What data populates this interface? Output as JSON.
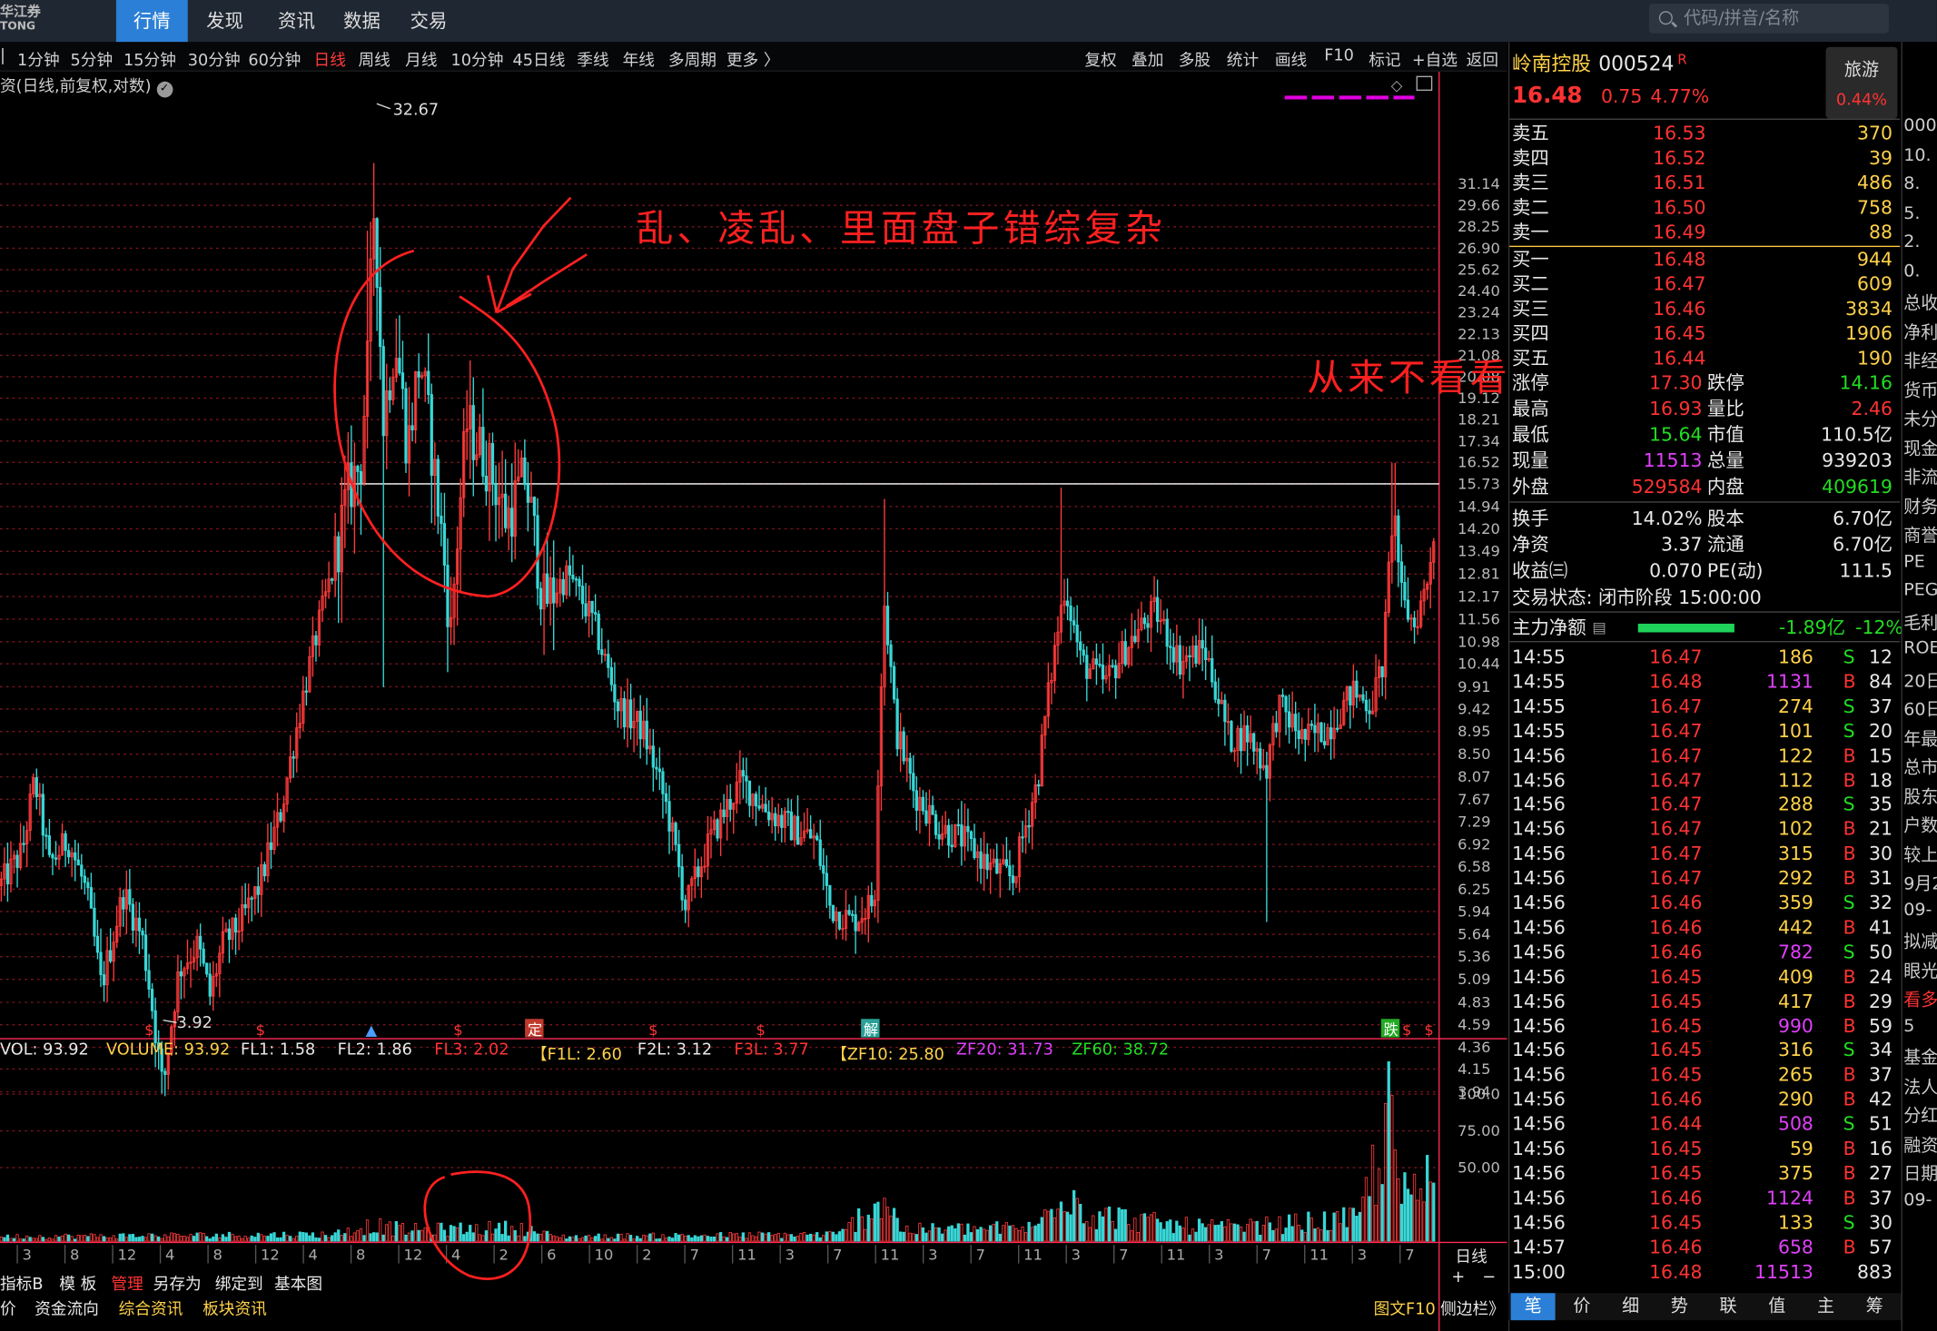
{
  "app": {
    "logo_lines": [
      "华江券",
      "TONG"
    ]
  },
  "menu": [
    "行情",
    "发现",
    "资讯",
    "数据",
    "交易"
  ],
  "search": {
    "placeholder": "代码/拼音/名称"
  },
  "periods": [
    "1分钟",
    "5分钟",
    "15分钟",
    "30分钟",
    "60分钟",
    "日线",
    "周线",
    "月线",
    "10分钟",
    "45日线",
    "季线",
    "年线",
    "多周期",
    "更多 〉"
  ],
  "tools": [
    "复权",
    "叠加",
    "多股",
    "统计",
    "画线",
    "F10",
    "标记",
    "+自选",
    "返回"
  ],
  "chart": {
    "title": "资(日线,前复权,对数)",
    "high_label": "32.67",
    "low_label": "3.92",
    "ref_line": 15.73,
    "axis_ticks": [
      "31.14",
      "29.66",
      "28.25",
      "26.90",
      "25.62",
      "24.40",
      "23.24",
      "22.13",
      "21.08",
      "20.08",
      "19.12",
      "18.21",
      "17.34",
      "16.52",
      "15.73",
      "14.94",
      "14.20",
      "13.49",
      "12.81",
      "12.17",
      "11.56",
      "10.98",
      "10.44",
      "9.91",
      "9.42",
      "8.95",
      "8.50",
      "8.07",
      "7.67",
      "7.29",
      "6.92",
      "6.58",
      "6.25",
      "5.94",
      "5.64",
      "5.36",
      "5.09",
      "4.83",
      "4.59",
      "4.36",
      "4.15",
      "3.94"
    ],
    "markers": [
      "$",
      "$",
      "$",
      "$",
      "定",
      "$",
      "$",
      "解",
      "跌",
      "$",
      "$"
    ],
    "date_labels": [
      "3",
      "8",
      "12",
      "4",
      "8",
      "12",
      "4",
      "8",
      "12",
      "4",
      "2",
      "6",
      "10",
      "2",
      "7",
      "11",
      "3",
      "7",
      "11",
      "3",
      "7",
      "11",
      "3",
      "7",
      "11",
      "3",
      "7",
      "11",
      "3",
      "7"
    ],
    "period_tag": "日线"
  },
  "volume": {
    "legend": [
      [
        "VOL: 93.92",
        "#e8e8e8"
      ],
      [
        "VOLUME: 93.92",
        "#ffd24a"
      ],
      [
        "FL1: 1.58",
        "#e8e8e8"
      ],
      [
        "FL2: 1.86",
        "#e8e8e8"
      ],
      [
        "FL3: 2.02",
        "#ff3333"
      ],
      [
        "【F1L: 2.60",
        "#ffd24a"
      ],
      [
        "F2L: 3.12",
        "#e8e8e8"
      ],
      [
        "F3L: 3.77",
        "#ff3333"
      ],
      [
        "【ZF10: 25.80",
        "#ffd24a"
      ],
      [
        "ZF20: 31.73",
        "#e040fb"
      ],
      [
        "ZF60: 38.72",
        "#22dd22"
      ]
    ],
    "axis": [
      "100.0",
      "75.00",
      "50.00"
    ]
  },
  "bottom": {
    "tabs1": [
      "指标B",
      "模 板",
      "管理",
      "另存为",
      "绑定到",
      "基本图"
    ],
    "tabs2": [
      "价",
      "资金流向",
      "综合资讯",
      "板块资讯"
    ],
    "right_links": [
      "图文F10",
      "侧边栏》"
    ]
  },
  "annotations": {
    "text1": "乱、凌乱、里面盘子错综复杂",
    "text2": "从来不看看走势，先脑往里冲"
  },
  "quote": {
    "name": "岭南控股",
    "code": "000524",
    "flag": "R",
    "price": "16.48",
    "change": "0.75",
    "pct": "4.77%",
    "sector": "旅游",
    "sector_pct": "0.44%",
    "asks": [
      [
        "卖五",
        "16.53",
        "370"
      ],
      [
        "卖四",
        "16.52",
        "39"
      ],
      [
        "卖三",
        "16.51",
        "486"
      ],
      [
        "卖二",
        "16.50",
        "758"
      ],
      [
        "卖一",
        "16.49",
        "88"
      ]
    ],
    "bids": [
      [
        "买一",
        "16.48",
        "944"
      ],
      [
        "买二",
        "16.47",
        "609"
      ],
      [
        "买三",
        "16.46",
        "3834"
      ],
      [
        "买四",
        "16.45",
        "1906"
      ],
      [
        "买五",
        "16.44",
        "190"
      ]
    ],
    "stats": [
      [
        "涨停",
        "17.30",
        "跌停",
        "14.16"
      ],
      [
        "最高",
        "16.93",
        "量比",
        "2.46"
      ],
      [
        "最低",
        "15.64",
        "市值",
        "110.5亿"
      ],
      [
        "现量",
        "11513",
        "总量",
        "939203"
      ],
      [
        "外盘",
        "529584",
        "内盘",
        "409619"
      ]
    ],
    "stats2": [
      [
        "换手",
        "14.02%",
        "股本",
        "6.70亿"
      ],
      [
        "净资",
        "3.37",
        "流通",
        "6.70亿"
      ],
      [
        "收益㈢",
        "0.070",
        "PE(动)",
        "111.5"
      ]
    ],
    "status": "交易状态: 闭市阶段 15:00:00",
    "flow": {
      "label": "主力净额",
      "value": "-1.89亿",
      "pct": "-12%"
    }
  },
  "ticks": [
    [
      "14:55",
      "16.47",
      "186",
      "S",
      "12"
    ],
    [
      "14:55",
      "16.48",
      "1131",
      "B",
      "84"
    ],
    [
      "14:55",
      "16.47",
      "274",
      "S",
      "37"
    ],
    [
      "14:55",
      "16.47",
      "101",
      "S",
      "20"
    ],
    [
      "14:56",
      "16.47",
      "122",
      "B",
      "15"
    ],
    [
      "14:56",
      "16.47",
      "112",
      "B",
      "18"
    ],
    [
      "14:56",
      "16.47",
      "288",
      "S",
      "35"
    ],
    [
      "14:56",
      "16.47",
      "102",
      "B",
      "21"
    ],
    [
      "14:56",
      "16.47",
      "315",
      "B",
      "30"
    ],
    [
      "14:56",
      "16.47",
      "292",
      "B",
      "31"
    ],
    [
      "14:56",
      "16.46",
      "359",
      "S",
      "32"
    ],
    [
      "14:56",
      "16.46",
      "442",
      "B",
      "41"
    ],
    [
      "14:56",
      "16.46",
      "782",
      "S",
      "50"
    ],
    [
      "14:56",
      "16.45",
      "409",
      "B",
      "24"
    ],
    [
      "14:56",
      "16.45",
      "417",
      "B",
      "29"
    ],
    [
      "14:56",
      "16.45",
      "990",
      "B",
      "59"
    ],
    [
      "14:56",
      "16.45",
      "316",
      "S",
      "34"
    ],
    [
      "14:56",
      "16.45",
      "265",
      "B",
      "37"
    ],
    [
      "14:56",
      "16.46",
      "290",
      "B",
      "42"
    ],
    [
      "14:56",
      "16.44",
      "508",
      "S",
      "51"
    ],
    [
      "14:56",
      "16.45",
      "59",
      "B",
      "16"
    ],
    [
      "14:56",
      "16.45",
      "375",
      "B",
      "27"
    ],
    [
      "14:56",
      "16.46",
      "1124",
      "B",
      "37"
    ],
    [
      "14:56",
      "16.45",
      "133",
      "S",
      "30"
    ],
    [
      "14:57",
      "16.46",
      "658",
      "B",
      "57"
    ],
    [
      "15:00",
      "16.48",
      "11513",
      "",
      "883"
    ]
  ],
  "rtabs": [
    "笔",
    "价",
    "细",
    "势",
    "联",
    "值",
    "主",
    "筹"
  ],
  "far_right": [
    "000",
    "10.",
    "8.",
    "5.",
    "2.",
    "0.",
    "总收",
    "净利",
    "非经",
    "货币",
    "未分",
    "现金",
    "非流",
    "财务",
    "商誉",
    "PE",
    "PEG",
    "毛利",
    "ROE",
    "20日",
    "60日",
    "年最",
    "总市",
    "股东",
    "户数",
    "较上",
    "9月2",
    "09-",
    "拟减",
    "眼光",
    "看多",
    "5",
    "基金",
    "法人",
    "分红",
    "融资",
    "日期",
    "09-"
  ]
}
